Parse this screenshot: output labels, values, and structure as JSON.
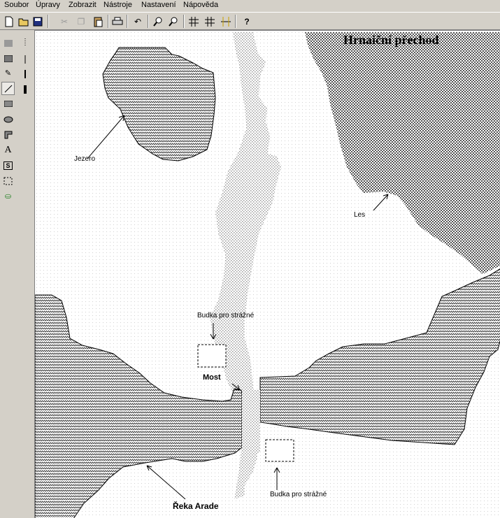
{
  "menu": [
    "Soubor",
    "Úpravy",
    "Zobrazit",
    "Nástroje",
    "Nastavení",
    "Nápověda"
  ],
  "toolbar_icons": [
    "new-document-icon",
    "open-folder-icon",
    "save-icon",
    "cut-icon",
    "copy-icon",
    "paste-icon",
    "print-icon",
    "undo-icon",
    "zoom-in-icon",
    "zoom-out-icon",
    "grid-icon",
    "grid-snap-icon",
    "guides-icon",
    "help-icon"
  ],
  "tools": [
    "fill-pattern-icon",
    "hatch-pattern-icon",
    "pencil-icon",
    "line-icon",
    "rectangle-icon",
    "ellipse-icon",
    "polyline-icon",
    "text-tool-icon",
    "symbol-icon",
    "selection-icon",
    "paint-bucket-icon"
  ],
  "text_tool_glyph": "A",
  "symbol_glyph": "S",
  "map": {
    "title": "Hrnaiční přechod",
    "labels": {
      "lake": "Jezero",
      "forest": "Les",
      "guard_top": "Budka pro strážné",
      "bridge": "Most",
      "guard_bottom": "Budka pro strážné",
      "river": "Řeka Arade"
    }
  },
  "colors": {
    "chrome": "#d4d0c8",
    "canvas": "#ffffff",
    "ink": "#000000"
  }
}
